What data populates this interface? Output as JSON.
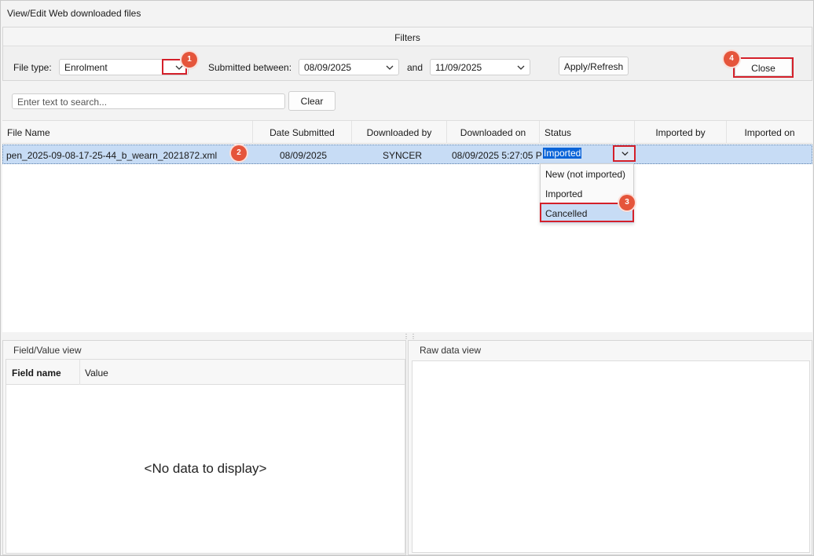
{
  "window": {
    "title": "View/Edit Web downloaded files"
  },
  "filters": {
    "header": "Filters",
    "file_type_label": "File type:",
    "file_type_value": "Enrolment",
    "submitted_between_label": "Submitted between:",
    "date_from": "08/09/2025",
    "and_label": "and",
    "date_to": "11/09/2025",
    "apply_label": "Apply/Refresh",
    "close_label": "Close"
  },
  "search": {
    "placeholder": "Enter text to search...",
    "clear_label": "Clear"
  },
  "grid": {
    "columns": [
      "File Name",
      "Date Submitted",
      "Downloaded by",
      "Downloaded on",
      "Status",
      "Imported by",
      "Imported on"
    ],
    "rows": [
      {
        "file_name": "pen_2025-09-08-17-25-44_b_wearn_2021872.xml",
        "date_submitted": "08/09/2025",
        "downloaded_by": "SYNCER",
        "downloaded_on": "08/09/2025 5:27:05 P",
        "status": "Imported",
        "imported_by": "",
        "imported_on": ""
      }
    ]
  },
  "status_dropdown": {
    "options": [
      "New (not imported)",
      "Imported",
      "Cancelled"
    ],
    "highlighted": "Cancelled"
  },
  "callouts": [
    "1",
    "2",
    "3",
    "4"
  ],
  "field_value_view": {
    "title": "Field/Value view",
    "col_field": "Field name",
    "col_value": "Value",
    "empty_text": "<No data to display>"
  },
  "raw_data_view": {
    "title": "Raw data view"
  },
  "colors": {
    "accent": "#0a64d8",
    "annotation_red": "#d4202a",
    "callout": "#e5553b",
    "row_selected": "#c7dcf5"
  }
}
